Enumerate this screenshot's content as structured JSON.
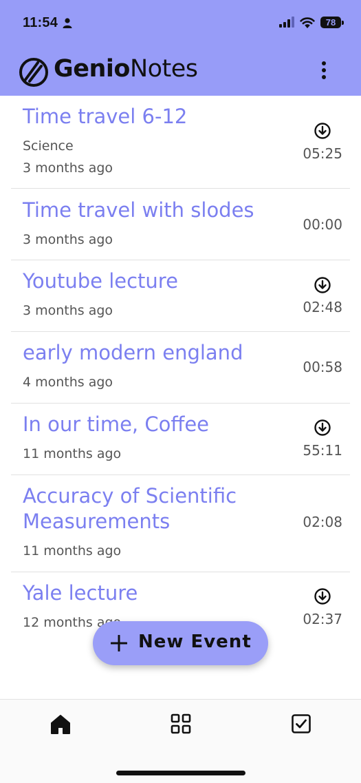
{
  "status_bar": {
    "time": "11:54",
    "battery": "78"
  },
  "app": {
    "brand_part1": "Genio",
    "brand_part2": "Notes"
  },
  "events": [
    {
      "title": "Time travel 6-12",
      "category": "Science",
      "age": "3 months ago",
      "duration": "05:25",
      "downloadable": true
    },
    {
      "title": "Time travel with slodes",
      "age": "3 months ago",
      "duration": "00:00",
      "downloadable": false
    },
    {
      "title": "Youtube lecture",
      "age": "3 months ago",
      "duration": "02:48",
      "downloadable": true
    },
    {
      "title": "early modern england",
      "age": "4 months ago",
      "duration": "00:58",
      "downloadable": false
    },
    {
      "title": "In our time, Coffee",
      "age": "11 months ago",
      "duration": "55:11",
      "downloadable": true
    },
    {
      "title_line1": "Accuracy of Scientific",
      "title_line2": "Measurements",
      "age": "11 months ago",
      "duration": "02:08",
      "downloadable": false
    },
    {
      "title": "Yale lecture",
      "age": "12 months ago",
      "duration": "02:37",
      "downloadable": true
    }
  ],
  "fab": {
    "label": "New Event"
  },
  "nav": {
    "items": [
      "home-icon",
      "grid-icon",
      "tasks-icon"
    ]
  },
  "colors": {
    "header": "#979cf8",
    "accent": "#7b7ff0",
    "fab": "#9a9ef8"
  }
}
